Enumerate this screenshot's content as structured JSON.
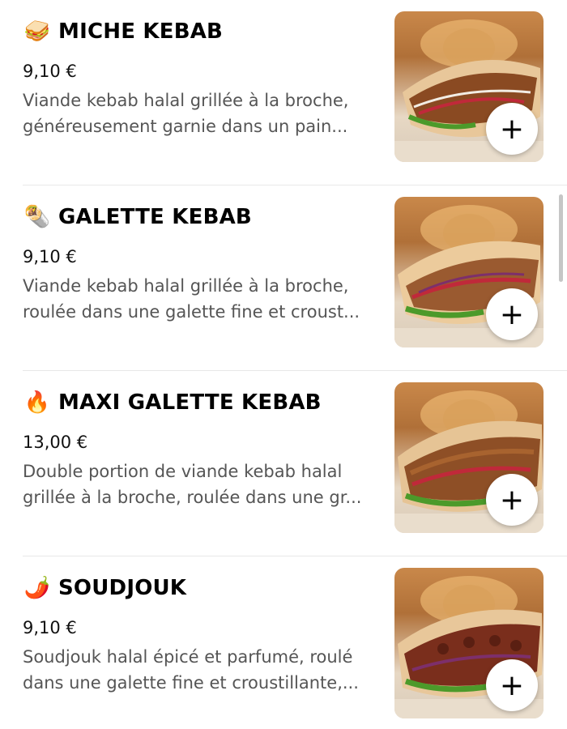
{
  "colors": {
    "divider": "#e8e8e8",
    "description": "#555555",
    "scrollbar": "#c6c6c6"
  },
  "items": [
    {
      "emoji": "🥪",
      "emoji_name": "sandwich-icon",
      "name": "MICHE KEBAB",
      "price": "9,10 €",
      "description": "Viande kebab halal grillée à la broche, généreusement garnie dans un pain...",
      "add_label": "+"
    },
    {
      "emoji": "🌯",
      "emoji_name": "burrito-icon",
      "name": "GALETTE KEBAB",
      "price": "9,10 €",
      "description": "Viande kebab halal grillée à la broche, roulée dans une galette fine et croust...",
      "add_label": "+"
    },
    {
      "emoji": "🔥",
      "emoji_name": "fire-icon",
      "name": "MAXI GALETTE KEBAB",
      "price": "13,00 €",
      "description": "Double portion de viande kebab halal grillée à la broche, roulée dans une gr...",
      "add_label": "+"
    },
    {
      "emoji": "🌶️",
      "emoji_name": "chili-pepper-icon",
      "name": "SOUDJOUK",
      "price": "9,10 €",
      "description": "Soudjouk halal épicé et parfumé, roulé dans une galette fine et croustillante,...",
      "add_label": "+"
    }
  ]
}
